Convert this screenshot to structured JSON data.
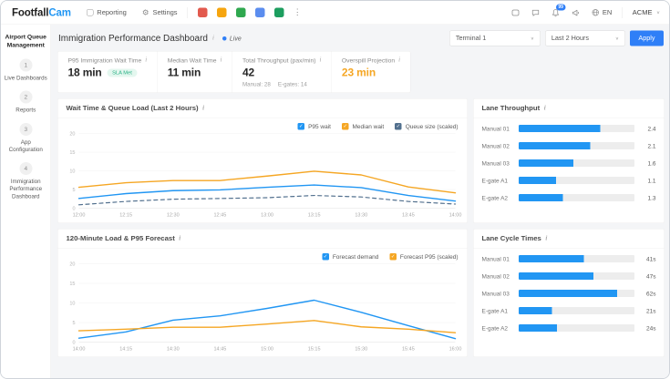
{
  "topnav": {
    "logo_black": "Footfall",
    "logo_blue": "Cam",
    "reporting_label": "Reporting",
    "settings_label": "Settings",
    "app_tiles": [
      {
        "color": "#e25a4e"
      },
      {
        "color": "#f6a50f"
      },
      {
        "color": "#2fa84f"
      },
      {
        "color": "#5b8def"
      },
      {
        "color": "#1d9e5f"
      }
    ],
    "notifications_badge": "99",
    "locale": "EN",
    "org": "ACME"
  },
  "sidebar": {
    "title": "Airport Queue Management",
    "items": [
      {
        "num": "1",
        "label": "Live Dashboards"
      },
      {
        "num": "2",
        "label": "Reports"
      },
      {
        "num": "3",
        "label": "App Configuration"
      },
      {
        "num": "4",
        "label": "Immigration Performance Dashboard"
      }
    ]
  },
  "header": {
    "title": "Immigration Performance Dashboard",
    "live_label": "Live",
    "terminal_select": "Terminal 1",
    "range_select": "Last 2 Hours",
    "apply_label": "Apply"
  },
  "kpis": [
    {
      "id": "p95-wait-time",
      "label": "P95 Immigration Wait Time",
      "value": "18 min",
      "badge": "SLA Met"
    },
    {
      "id": "median-wait-time",
      "label": "Median Wait Time",
      "value": "11 min"
    },
    {
      "id": "total-throughput",
      "label": "Total Throughput (pax/min)",
      "value": "42",
      "subs": [
        "Manual: 28",
        "E-gates: 14"
      ]
    },
    {
      "id": "overspill-projection",
      "label": "Overspill Projection",
      "value": "23 min",
      "value_color": "#f5a623"
    }
  ],
  "colors": {
    "accent_blue": "#2f7ff7",
    "series_blue": "#2196f3",
    "series_orange": "#f5a623",
    "series_slate": "#52708e",
    "sla_green": "#27b084"
  },
  "chart_data": [
    {
      "type": "line",
      "title": "Wait Time & Queue Load (Last 2 Hours)",
      "x": [
        "12:00",
        "12:15",
        "12:30",
        "12:45",
        "13:00",
        "13:15",
        "13:30",
        "13:45",
        "14:00"
      ],
      "ylim": [
        0,
        20
      ],
      "yticks": [
        0,
        5,
        10,
        15,
        20
      ],
      "grid": "horizontal",
      "legend_position": "top-right",
      "series": [
        {
          "name": "P95 wait",
          "color": "#2196f3",
          "style": "solid",
          "values": [
            2.6,
            3.9,
            4.7,
            4.9,
            5.6,
            6.2,
            5.5,
            3.4,
            1.9
          ]
        },
        {
          "name": "Median wait",
          "color": "#f5a623",
          "style": "solid",
          "values": [
            5.6,
            6.8,
            7.4,
            7.4,
            8.6,
            9.9,
            8.9,
            5.7,
            4.1
          ]
        },
        {
          "name": "Queue size (scaled)",
          "color": "#52708e",
          "style": "dashed",
          "values": [
            0.9,
            1.8,
            2.4,
            2.6,
            2.8,
            3.4,
            3.0,
            1.8,
            1.1
          ]
        }
      ]
    },
    {
      "type": "line",
      "title": "120-Minute Load & P95 Forecast",
      "x": [
        "14:00",
        "14:15",
        "14:30",
        "14:45",
        "15:00",
        "15:15",
        "15:30",
        "15:45",
        "16:00"
      ],
      "ylim": [
        0,
        20
      ],
      "yticks": [
        0,
        5,
        10,
        15,
        20
      ],
      "grid": "horizontal",
      "legend_position": "top-right",
      "series": [
        {
          "name": "Forecast demand",
          "color": "#2196f3",
          "style": "solid",
          "values": [
            1.0,
            2.6,
            5.6,
            6.7,
            8.6,
            10.7,
            7.6,
            4.2,
            0.9
          ]
        },
        {
          "name": "Forecast P95 (scaled)",
          "color": "#f5a623",
          "style": "solid",
          "values": [
            2.9,
            3.3,
            3.8,
            3.8,
            4.6,
            5.5,
            3.9,
            3.3,
            2.4
          ]
        }
      ]
    },
    {
      "type": "bar",
      "title": "Lane Throughput",
      "categories": [
        "Manual 01",
        "Manual 02",
        "Manual 03",
        "E-gate A1",
        "E-gate A2"
      ],
      "values": [
        2.4,
        2.1,
        1.6,
        1.1,
        1.3
      ],
      "value_labels": [
        "2.4",
        "2.1",
        "1.6",
        "1.1",
        "1.3"
      ],
      "xlim": [
        0,
        3.4
      ],
      "bar_color": "#2196f3"
    },
    {
      "type": "bar",
      "title": "Lane Cycle Times",
      "categories": [
        "Manual 01",
        "Manual 02",
        "Manual 03",
        "E-gate A1",
        "E-gate A2"
      ],
      "values": [
        41,
        47,
        62,
        21,
        24
      ],
      "value_labels": [
        "41s",
        "47s",
        "62s",
        "21s",
        "24s"
      ],
      "xlim": [
        0,
        73
      ],
      "bar_color": "#2196f3"
    }
  ]
}
